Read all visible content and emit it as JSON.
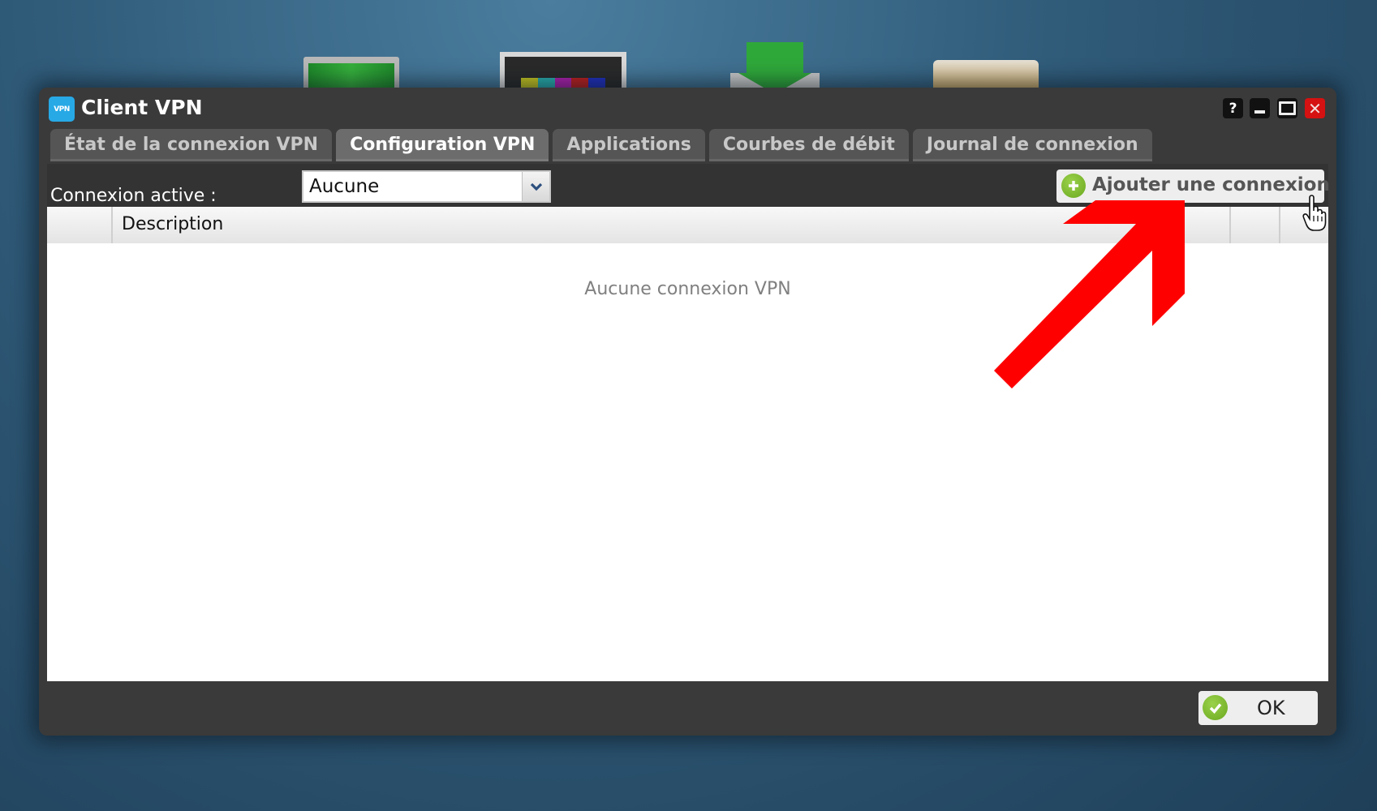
{
  "desktop": {
    "icons": [
      {
        "name": "monitor-icon"
      },
      {
        "name": "tv-icon"
      },
      {
        "name": "download-icon"
      },
      {
        "name": "folder-icon"
      }
    ]
  },
  "window": {
    "app_icon_text": "VPN",
    "title": "Client VPN",
    "controls": {
      "help": "?",
      "close": "✕"
    },
    "tabs": [
      {
        "label": "État de la connexion VPN",
        "active": false
      },
      {
        "label": "Configuration VPN",
        "active": true
      },
      {
        "label": "Applications",
        "active": false
      },
      {
        "label": "Courbes de débit",
        "active": false
      },
      {
        "label": "Journal de connexion",
        "active": false
      }
    ],
    "toolbar": {
      "active_connection_label": "Connexion active :",
      "active_connection_value": "Aucune",
      "add_connection_label": "Ajouter une connexion"
    },
    "table": {
      "columns": [
        "",
        "Description",
        "",
        ""
      ],
      "empty_message": "Aucune connexion VPN",
      "rows": []
    },
    "footer": {
      "ok_label": "OK"
    }
  },
  "annotation": {
    "arrow_color": "#ff0000"
  },
  "colors": {
    "window_bg": "#3a3a3a",
    "tab_active_bg": "#6c6c6c",
    "tab_bg": "#555555",
    "close_button": "#d51111",
    "accent_green": "#7fbf30",
    "app_icon_blue": "#27a9e6"
  }
}
